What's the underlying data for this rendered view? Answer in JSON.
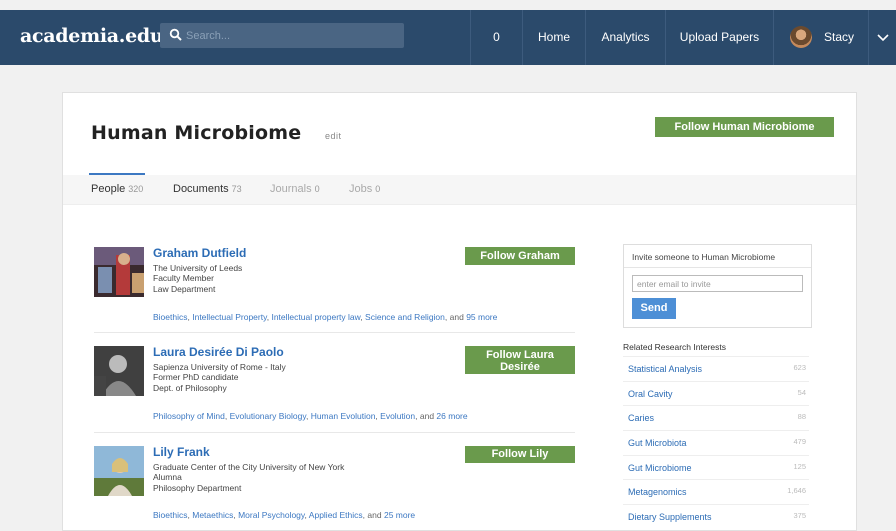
{
  "nav": {
    "logo": "academia.edu",
    "search_placeholder": "Search...",
    "count": "0",
    "home": "Home",
    "analytics": "Analytics",
    "upload": "Upload Papers",
    "user": "Stacy"
  },
  "page": {
    "title": "Human Microbiome",
    "edit": "edit",
    "follow_label": "Follow Human Microbiome"
  },
  "tabs": [
    {
      "label": "People",
      "count": "320"
    },
    {
      "label": "Documents",
      "count": "73"
    },
    {
      "label": "Journals",
      "count": "0"
    },
    {
      "label": "Jobs",
      "count": "0"
    }
  ],
  "people": [
    {
      "name": "Graham Dutfield",
      "lines": [
        "The University of Leeds",
        "Faculty Member",
        "Law Department"
      ],
      "follow": "Follow Graham",
      "interests": [
        "Bioethics",
        "Intellectual Property",
        "Intellectual property law",
        "Science and Religion"
      ],
      "more": "95 more"
    },
    {
      "name": "Laura Desirée Di Paolo",
      "lines": [
        "Sapienza University of Rome - Italy",
        "Former PhD candidate",
        "Dept. of Philosophy"
      ],
      "follow_line1": "Follow Laura",
      "follow_line2": "Desirée",
      "interests": [
        "Philosophy of Mind",
        "Evolutionary Biology",
        "Human Evolution",
        "Evolution"
      ],
      "more": "26 more"
    },
    {
      "name": "Lily Frank",
      "lines": [
        "Graduate Center of the City University of New York",
        "Alumna",
        "Philosophy Department"
      ],
      "follow": "Follow Lily",
      "interests": [
        "Bioethics",
        "Metaethics",
        "Moral Psychology",
        "Applied Ethics"
      ],
      "more": "25 more"
    }
  ],
  "and_text": "and",
  "invite": {
    "title": "Invite someone to Human Microbiome",
    "placeholder": "enter email to invite",
    "send": "Send"
  },
  "related": {
    "title": "Related Research Interests",
    "items": [
      {
        "label": "Statistical Analysis",
        "count": "623"
      },
      {
        "label": "Oral Cavity",
        "count": "54"
      },
      {
        "label": "Caries",
        "count": "88"
      },
      {
        "label": "Gut Microbiota",
        "count": "479"
      },
      {
        "label": "Gut Microbiome",
        "count": "125"
      },
      {
        "label": "Metagenomics",
        "count": "1,646"
      },
      {
        "label": "Dietary Supplements",
        "count": "375"
      }
    ]
  },
  "colors": {
    "navbar": "#2b4a6b",
    "follow_green": "#6a9a4c",
    "link_blue": "#2c6cb5",
    "send_blue": "#4d8fd6"
  }
}
